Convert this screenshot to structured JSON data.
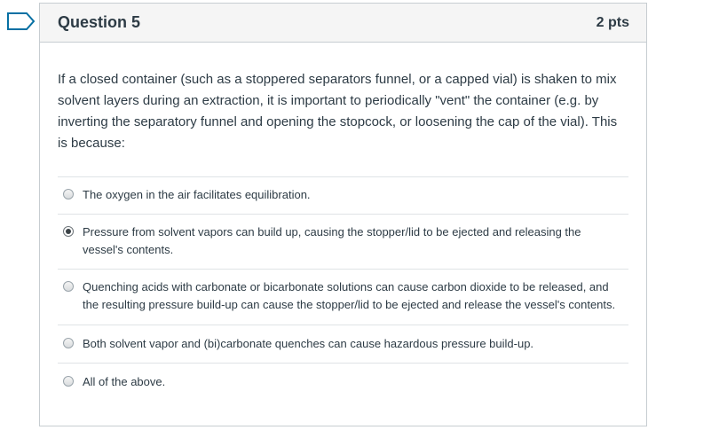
{
  "question": {
    "title": "Question 5",
    "points": "2 pts",
    "text": "If a closed container (such as a stoppered separators funnel, or a capped vial) is shaken to mix solvent layers during an extraction, it is important to periodically \"vent\" the container (e.g. by inverting the separatory funnel and opening the stopcock, or loosening the cap of the vial). This is because:",
    "flag_icon": "bookmark-flag-icon",
    "accent_color": "#0770a3"
  },
  "answers": [
    {
      "label": "The oxygen in the air facilitates equilibration.",
      "selected": false
    },
    {
      "label": "Pressure from solvent vapors can build up, causing the stopper/lid to be ejected and releasing the vessel's contents.",
      "selected": true
    },
    {
      "label": "Quenching acids with carbonate or bicarbonate solutions can cause carbon dioxide to be released, and the resulting pressure build-up can cause the stopper/lid to be ejected and release the vessel's contents.",
      "selected": false
    },
    {
      "label": "Both solvent vapor and (bi)carbonate quenches can cause hazardous pressure build-up.",
      "selected": false
    },
    {
      "label": "All of the above.",
      "selected": false
    }
  ]
}
